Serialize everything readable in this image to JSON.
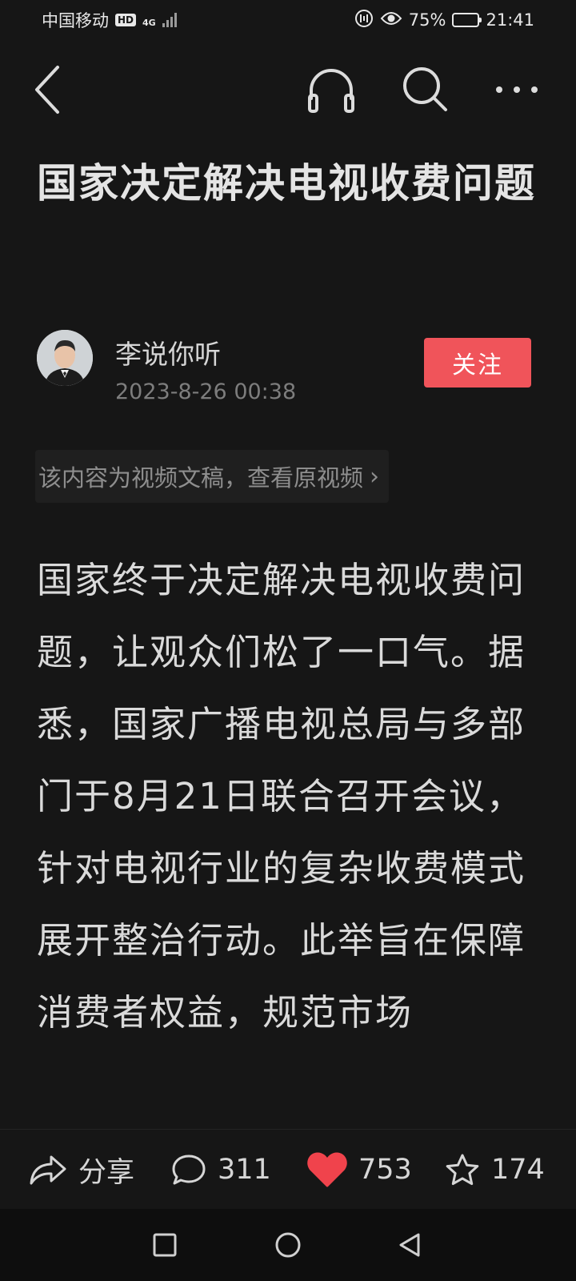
{
  "status_bar": {
    "carrier": "中国移动",
    "hd": "HD",
    "network": "4G",
    "battery_text": "75%",
    "battery_level": 0.75,
    "time": "21:41"
  },
  "article": {
    "title": "国家决定解决电视收费问题",
    "author": "李说你听",
    "date": "2023-8-26 00:38",
    "follow_label": "关注",
    "source_link": "该内容为视频文稿，查看原视频",
    "body": "国家终于决定解决电视收费问题，让观众们松了一口气。据悉，国家广播电视总局与多部门于8月21日联合召开会议，针对电视行业的复杂收费模式展开整治行动。此举旨在保障消费者权益，规范市场"
  },
  "actions": {
    "share_label": "分享",
    "comments_count": "311",
    "likes_count": "753",
    "favorites_count": "174"
  },
  "colors": {
    "background": "#161616",
    "follow_button": "#f0545a",
    "like_heart": "#f0434c"
  }
}
